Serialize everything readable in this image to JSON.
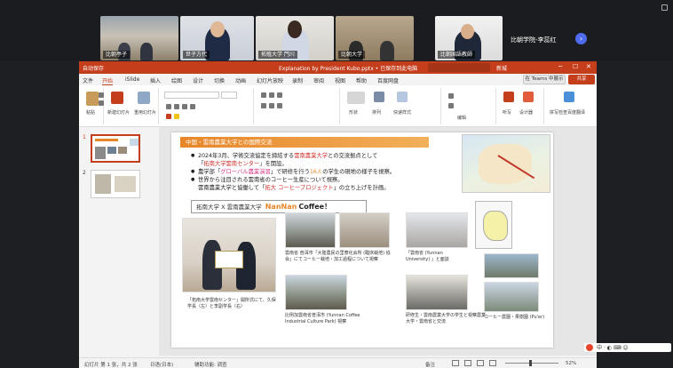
{
  "teams": {
    "tiles": [
      {
        "name": "比朝亭子"
      },
      {
        "name": "世子方代"
      },
      {
        "name": "拓殖大学 門川"
      },
      {
        "name": "比朝大学"
      },
      {
        "name": "比朝国語教師"
      }
    ],
    "side_name": "比朝学院-李蕊红",
    "side_sub": "比朝学院-李蕊红"
  },
  "ppt": {
    "title": "Explanation by President Kubo.pptx • 已保存到此电脑",
    "autosave": "自动保存",
    "user": "新城",
    "tabs": [
      "文件",
      "开始",
      "iSlide",
      "插入",
      "绘图",
      "设计",
      "切换",
      "动画",
      "幻灯片放映",
      "录制",
      "审阅",
      "视图",
      "帮助",
      "百度网盘"
    ],
    "teams_button": "在 Teams 中展示",
    "share_button": "共享",
    "ribbon": {
      "paste": "粘贴",
      "new_slide": "新建幻灯片",
      "reuse": "重用幻灯片",
      "shapes": "形状",
      "arrange": "排列",
      "quick_styles": "快速样式",
      "dictate": "听写",
      "designer": "设计器",
      "editor": "编辑",
      "copilot": "获取加载项",
      "ai": "拼写检查百度翻译"
    }
  },
  "thumbnails": [
    {
      "number": "1",
      "label": "slide-1"
    },
    {
      "number": "2",
      "label": "slide-2"
    }
  ],
  "slide": {
    "header": "中国・雲南農業大学との国際交流",
    "b1_a": "2024年3月、学術交流協定を締結する",
    "b1_hl": "雲南農業大学",
    "b1_b": "との交流拠点として",
    "b1_cont_open": "「",
    "b1_cont_hl": "拓南大学雲南センター",
    "b1_cont_close": "」を開設。",
    "b2_a": "農学部「",
    "b2_hl": "グローバル農業演習",
    "b2_b": "」で研修を行う",
    "b2_hl2": "16人",
    "b2_c": "の学生の現地の様子を視察。",
    "b3_a": "世界から注目される雲南省のコーヒー生産について視察。",
    "b3_cont_a": "雲南農業大学と協働して「",
    "b3_cont_hl": "拓大 コーヒープロジェクト",
    "b3_cont_b": "」の立ち上げを計画。",
    "nan_left": "拓南大学 X 雲南農業大学",
    "nan_brand": "NanNan",
    "nan_coffee": "Coffee！",
    "captions": {
      "c1": "「拓南大学雲南センター」開所式にて、久保学長（左）と李副学長（右）",
      "c2": "雲南省 普洱市「大陸農民の里寮化会所 (臨床栽培) 協会」にてコーヒー栽培・加工過程について視察",
      "c3": "「雲南省 (Yunnan University) 」と面談",
      "c4": "比例加雲南省普洱市 (Yunnan Coffee Industrial Culture Park) 視察",
      "c5": "研修生・雲南農業大学の学生と視察農業大学・雲南省と交流",
      "c6": "コーヒー農園・果樹園 (Pu'er)"
    }
  },
  "statusbar": {
    "slide_info": "幻灯片 第 1 张，共 2 张",
    "language": "日语(日本)",
    "accessibility": "辅助功能: 调查",
    "notes": "备注",
    "zoom": "52%"
  },
  "colors": {
    "ppt_accent": "#c43e1c",
    "header_orange": "#e8862a"
  }
}
